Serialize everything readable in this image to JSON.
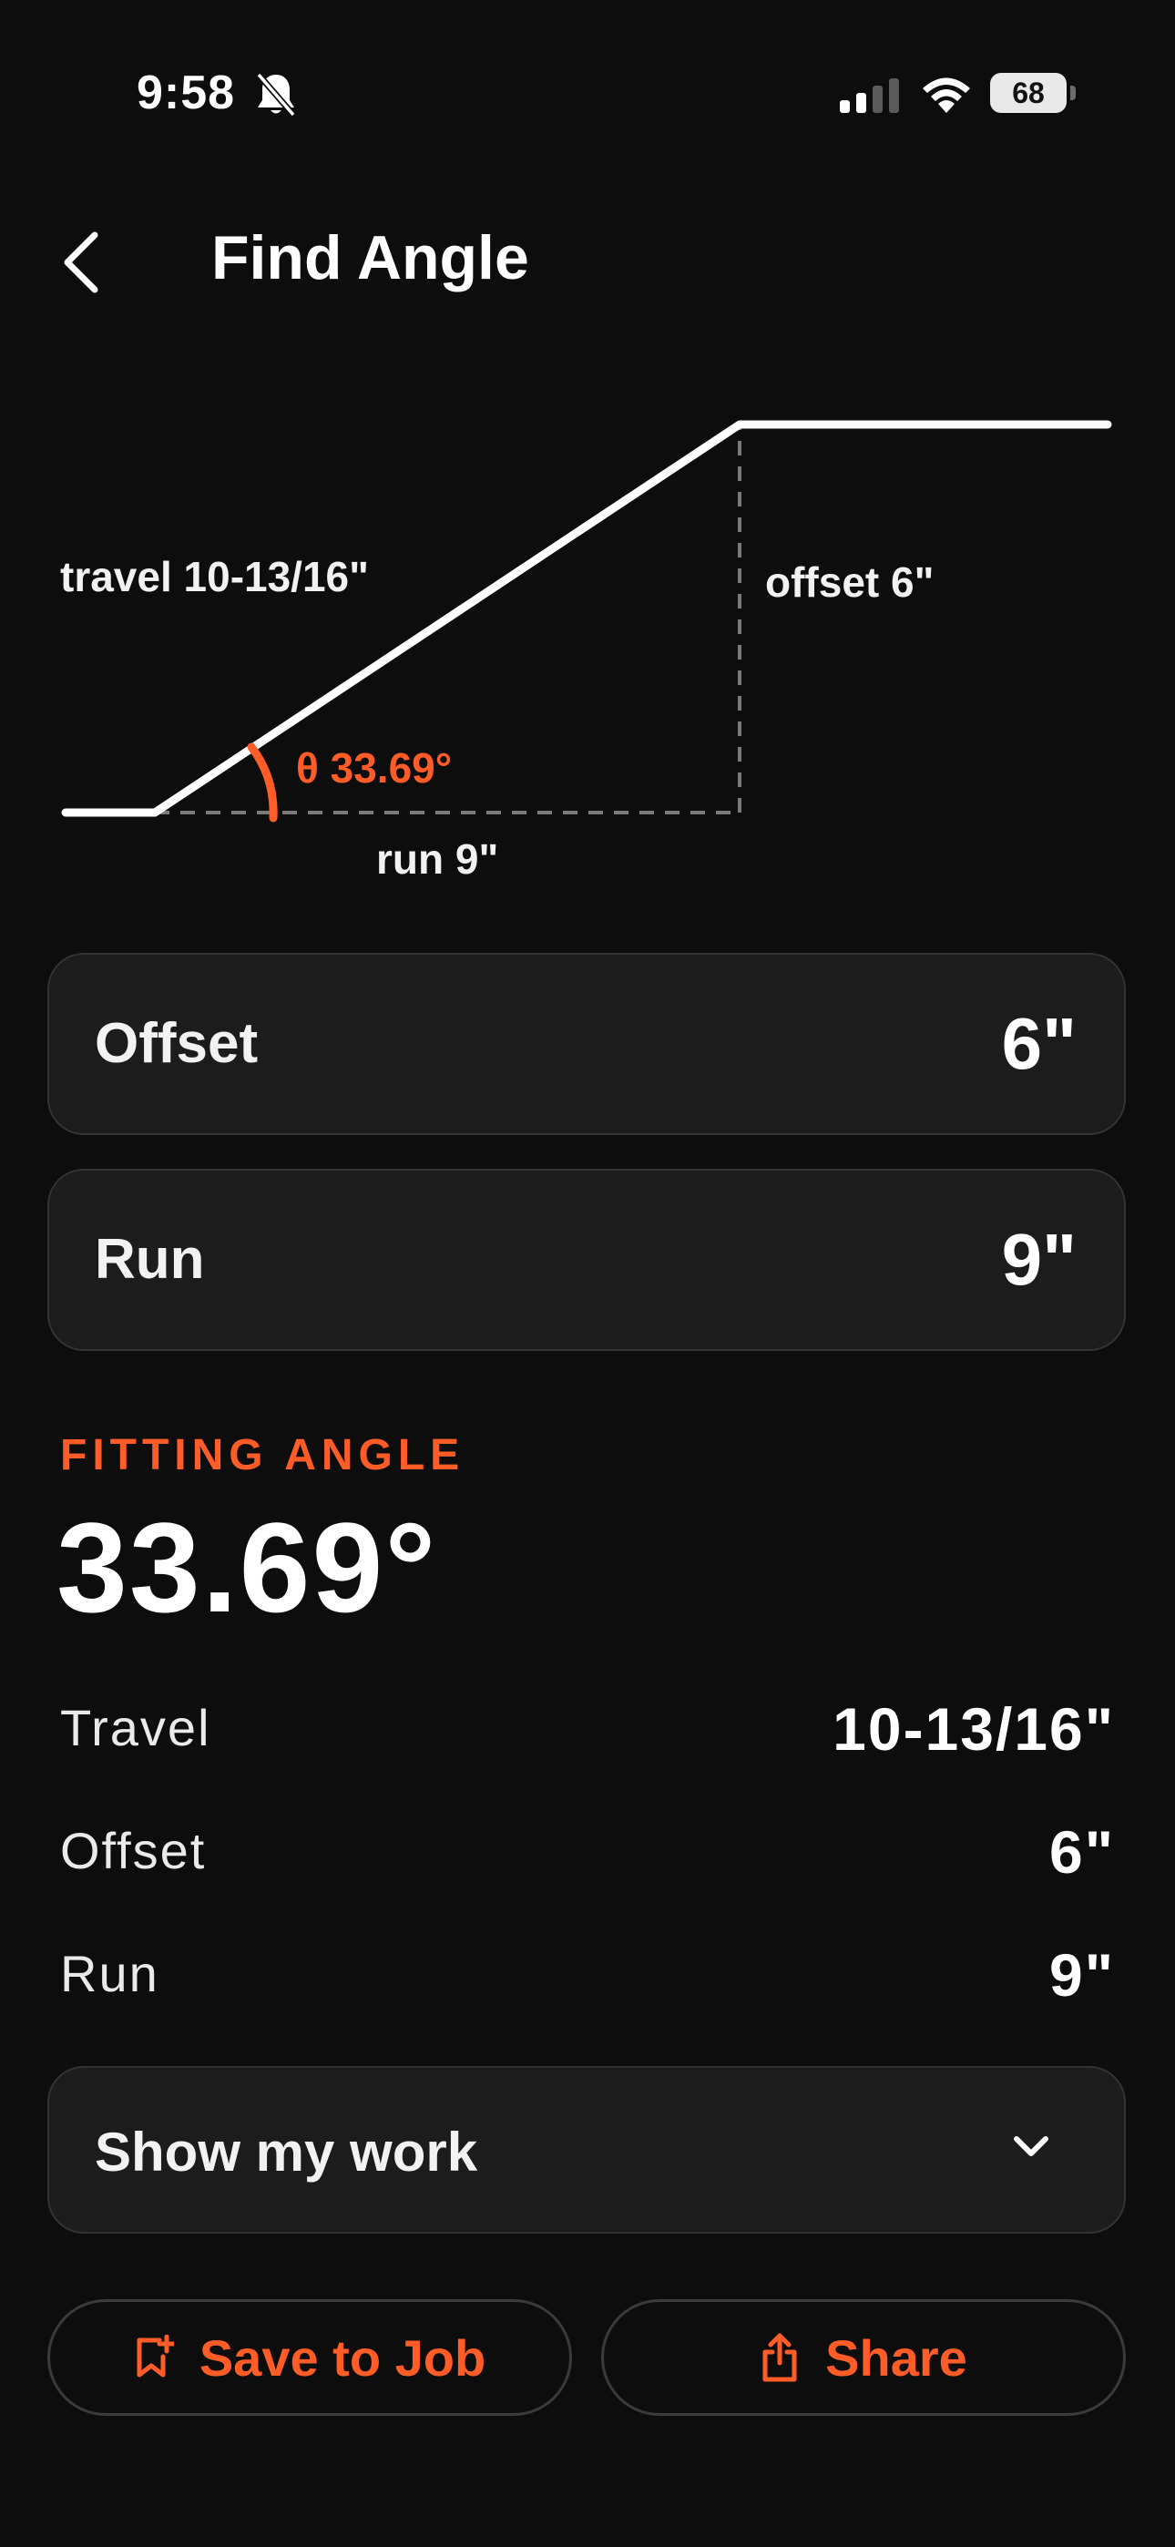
{
  "status_bar": {
    "time": "9:58",
    "battery": "68"
  },
  "header": {
    "title": "Find Angle"
  },
  "diagram": {
    "travel_label": "travel 10-13/16\"",
    "offset_label": "offset 6\"",
    "angle_label": "θ 33.69°",
    "run_label": "run 9\""
  },
  "inputs": {
    "offset": {
      "label": "Offset",
      "value": "6\""
    },
    "run": {
      "label": "Run",
      "value": "9\""
    }
  },
  "result": {
    "label": "FITTING ANGLE",
    "value": "33.69°"
  },
  "stats": {
    "travel": {
      "label": "Travel",
      "value": "10-13/16\""
    },
    "offset": {
      "label": "Offset",
      "value": "6\""
    },
    "run": {
      "label": "Run",
      "value": "9\""
    }
  },
  "show_work": {
    "label": "Show my work"
  },
  "actions": {
    "save_label": "Save to Job",
    "share_label": "Share"
  },
  "colors": {
    "background": "#0d0d0d",
    "card": "#1c1c1c",
    "accent": "#ff5c28",
    "text": "#f2f2f2"
  },
  "icons": [
    "bell-slash-icon",
    "cellular-signal-icon",
    "wifi-icon",
    "battery-icon",
    "back-chevron-icon",
    "chevron-down-icon",
    "bookmark-add-icon",
    "share-icon"
  ]
}
